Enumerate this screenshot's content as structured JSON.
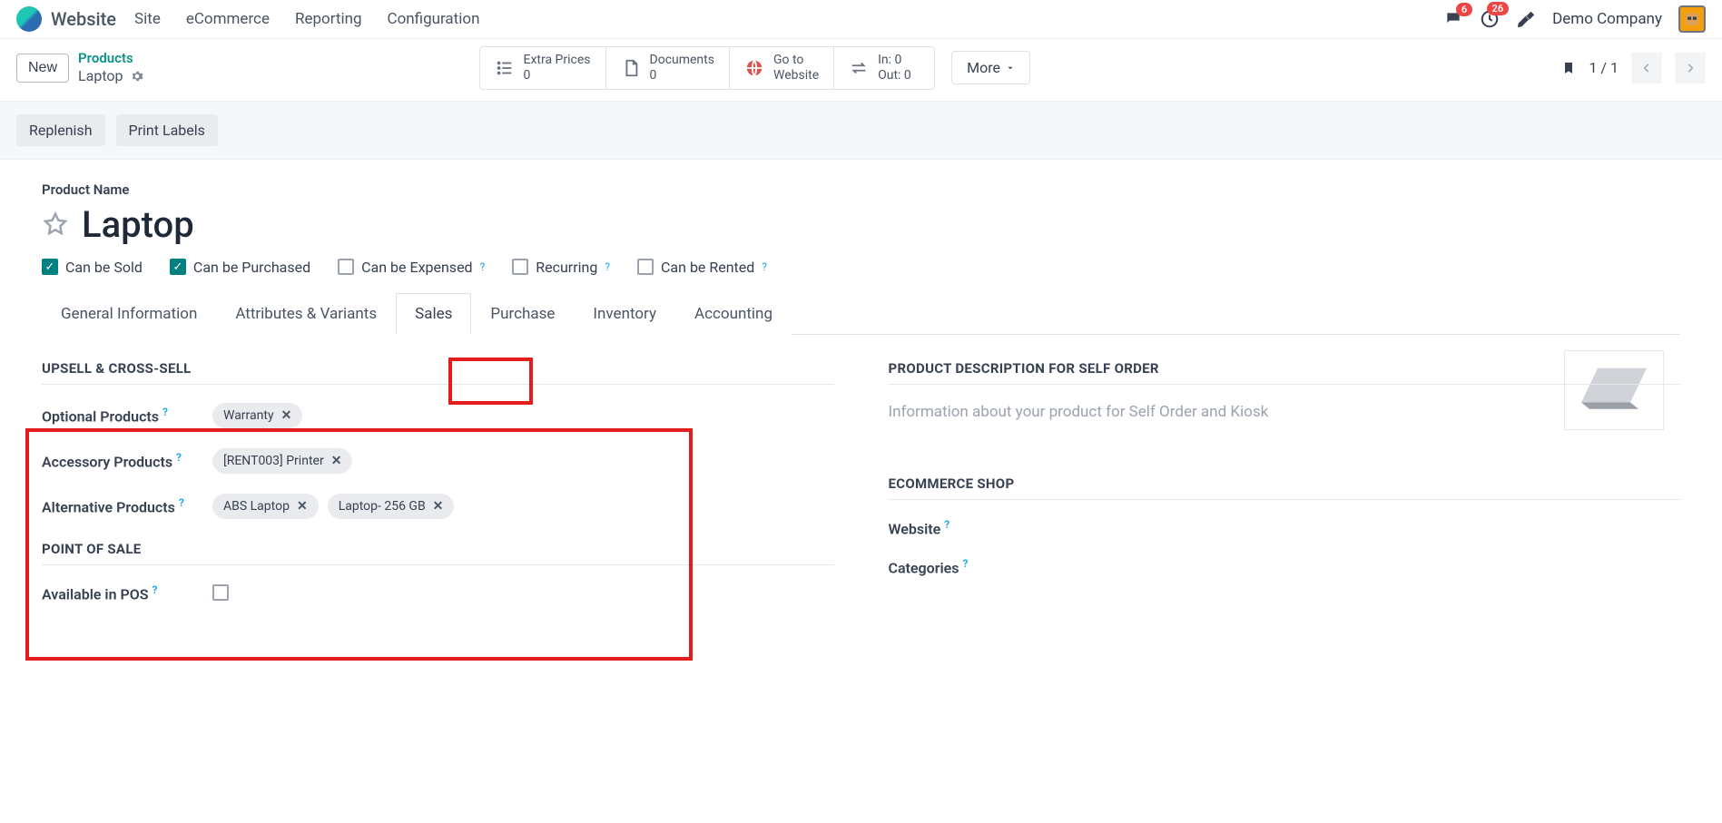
{
  "brand": {
    "name": "Website"
  },
  "menu": [
    "Site",
    "eCommerce",
    "Reporting",
    "Configuration"
  ],
  "topright": {
    "chat_badge": "6",
    "activity_badge": "26",
    "company": "Demo Company"
  },
  "breadcrumb": {
    "new_label": "New",
    "parent": "Products",
    "current": "Laptop"
  },
  "stats": {
    "extra_prices": {
      "label": "Extra Prices",
      "value": "0"
    },
    "documents": {
      "label": "Documents",
      "value": "0"
    },
    "website": {
      "line1": "Go to",
      "line2": "Website"
    },
    "inout": {
      "in": "In: 0",
      "out": "Out: 0"
    },
    "more": "More"
  },
  "pager": {
    "text": "1 / 1"
  },
  "actions": {
    "replenish": "Replenish",
    "print_labels": "Print Labels"
  },
  "form": {
    "product_name_label": "Product Name",
    "product_name": "Laptop",
    "checks": {
      "sold": "Can be Sold",
      "purchased": "Can be Purchased",
      "expensed": "Can be Expensed",
      "recurring": "Recurring",
      "rented": "Can be Rented"
    }
  },
  "tabs": [
    "General Information",
    "Attributes & Variants",
    "Sales",
    "Purchase",
    "Inventory",
    "Accounting"
  ],
  "sales": {
    "upsell_title": "UPSELL & CROSS-SELL",
    "optional_label": "Optional Products",
    "optional": [
      "Warranty"
    ],
    "accessory_label": "Accessory Products",
    "accessory": [
      "[RENT003] Printer"
    ],
    "alternative_label": "Alternative Products",
    "alternative": [
      "ABS Laptop",
      "Laptop- 256 GB"
    ],
    "pos_title": "POINT OF SALE",
    "pos_label": "Available in POS",
    "desc_title": "PRODUCT DESCRIPTION FOR SELF ORDER",
    "desc_placeholder": "Information about your product for Self Order and Kiosk",
    "shop_title": "ECOMMERCE SHOP",
    "website_label": "Website",
    "categories_label": "Categories"
  }
}
